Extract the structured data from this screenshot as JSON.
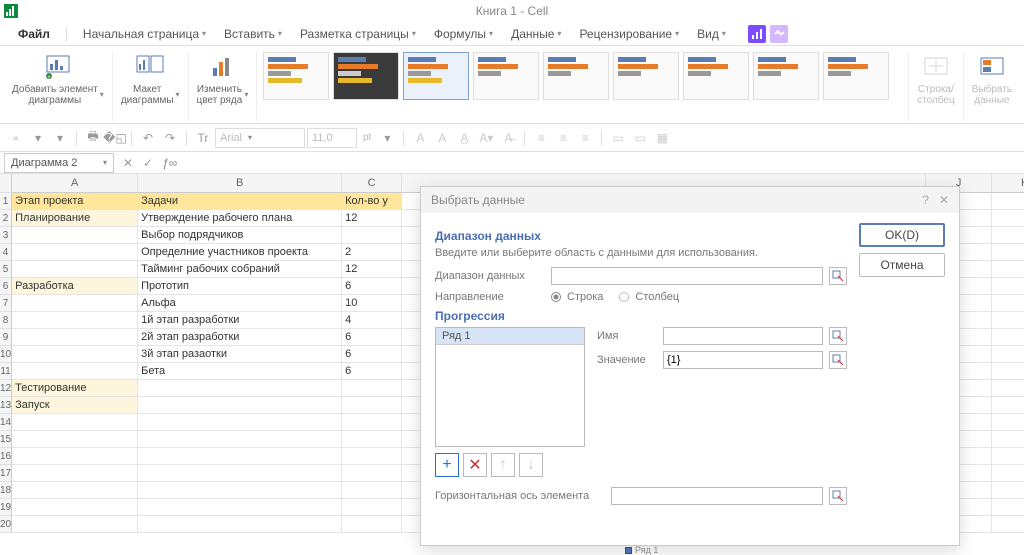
{
  "title": "Книга 1 - Cell",
  "menu": {
    "file": "Файл",
    "items": [
      "Начальная страница",
      "Вставить",
      "Разметка страницы",
      "Формулы",
      "Данные",
      "Рецензирование",
      "Вид"
    ]
  },
  "ribbon": {
    "add_element": "Добавить элемент\nдиаграммы",
    "layout": "Макет\nдиаграммы",
    "color": "Изменить\nцвет ряда",
    "rowcol": "Строка/\nстолбец",
    "select_data": "Выбрать\nданные"
  },
  "toolbar": {
    "font": "Arial",
    "size": "11,0",
    "pt": "pt"
  },
  "namebox": "Диаграмма 2",
  "columns": [
    "A",
    "B",
    "C",
    "J",
    "K"
  ],
  "rows": [
    {
      "a": "Этап проекта",
      "b": "Задачи",
      "c": "Кол-во у",
      "cls": "hdr-yellow"
    },
    {
      "a": "Планирование",
      "b": "Утверждение рабочего плана",
      "c": "12",
      "cls": "hdr-cream-a"
    },
    {
      "a": "",
      "b": "Выбор подрядчиков",
      "c": ""
    },
    {
      "a": "",
      "b": "Определние участников проекта",
      "c": "2"
    },
    {
      "a": "",
      "b": "Тайминг рабочих собраний",
      "c": "12"
    },
    {
      "a": "Разработка",
      "b": "Прототип",
      "c": "6",
      "cls": "hdr-cream-a"
    },
    {
      "a": "",
      "b": "Альфа",
      "c": "10"
    },
    {
      "a": "",
      "b": "1й этап разработки",
      "c": "4"
    },
    {
      "a": "",
      "b": "2й этап разработки",
      "c": "6"
    },
    {
      "a": "",
      "b": "3й этап разаотки",
      "c": "6"
    },
    {
      "a": "",
      "b": "Бета",
      "c": "6"
    },
    {
      "a": "Тестирование",
      "b": "",
      "c": "",
      "cls": "hdr-cream-a"
    },
    {
      "a": "Запуск",
      "b": "",
      "c": "",
      "cls": "hdr-cream-a"
    },
    {
      "a": "",
      "b": "",
      "c": ""
    },
    {
      "a": "",
      "b": "",
      "c": ""
    },
    {
      "a": "",
      "b": "",
      "c": ""
    },
    {
      "a": "",
      "b": "",
      "c": ""
    },
    {
      "a": "",
      "b": "",
      "c": ""
    },
    {
      "a": "",
      "b": "",
      "c": ""
    },
    {
      "a": "",
      "b": "",
      "c": ""
    }
  ],
  "dialog": {
    "title": "Выбрать данные",
    "ok": "OK(D)",
    "cancel": "Отмена",
    "range_section": "Диапазон данных",
    "range_hint": "Введите или выберите область с данными для использования.",
    "range_label": "Диапазон данных",
    "direction": "Направление",
    "dir_row": "Строка",
    "dir_col": "Столбец",
    "series_section": "Прогрессия",
    "series_item": "Ряд 1",
    "name": "Имя",
    "value": "Значение",
    "value_val": "{1}",
    "haxis": "Горизонтальная ось элемента"
  },
  "legend": "Ряд 1"
}
